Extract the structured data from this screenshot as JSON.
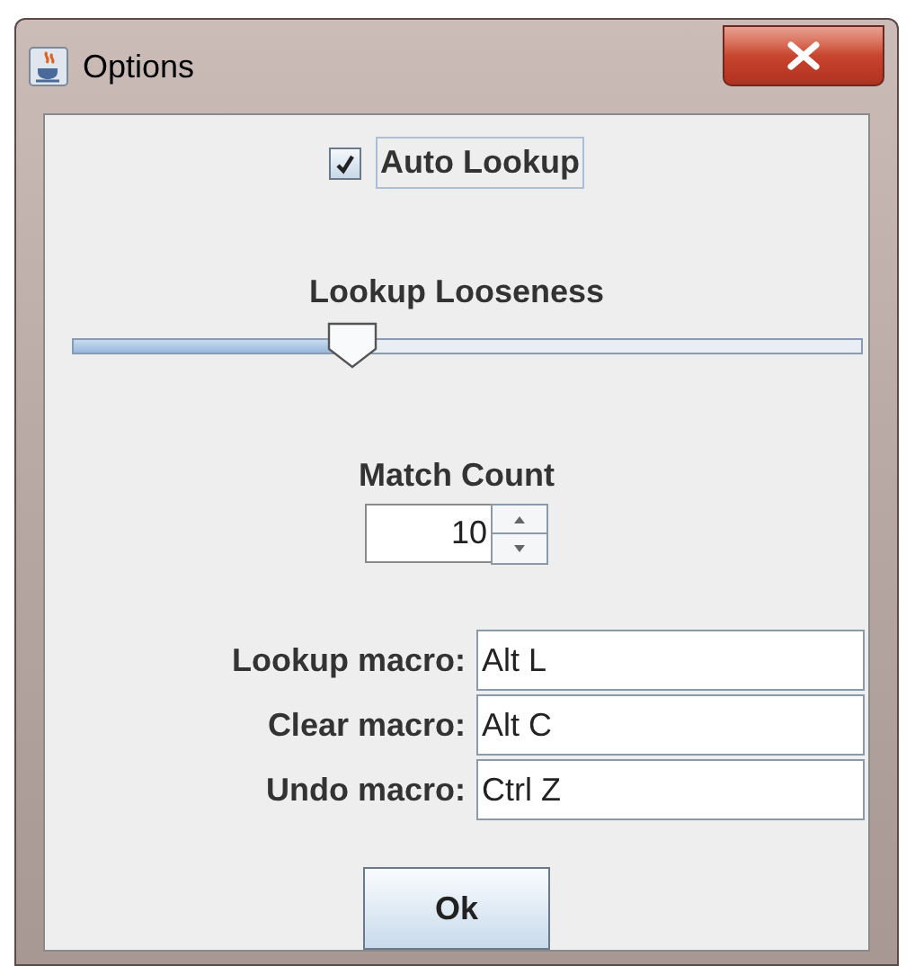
{
  "window": {
    "title": "Options"
  },
  "auto_lookup": {
    "label": "Auto Lookup",
    "checked": true
  },
  "looseness": {
    "label": "Lookup Looseness",
    "level": 0.355
  },
  "match_count": {
    "label": "Match Count",
    "value": "10"
  },
  "macros": [
    {
      "label": "Lookup macro:",
      "value": "Alt L"
    },
    {
      "label": "Clear macro:",
      "value": "Alt C"
    },
    {
      "label": "Undo macro:",
      "value": "Ctrl Z"
    }
  ],
  "buttons": [
    "Ok"
  ]
}
